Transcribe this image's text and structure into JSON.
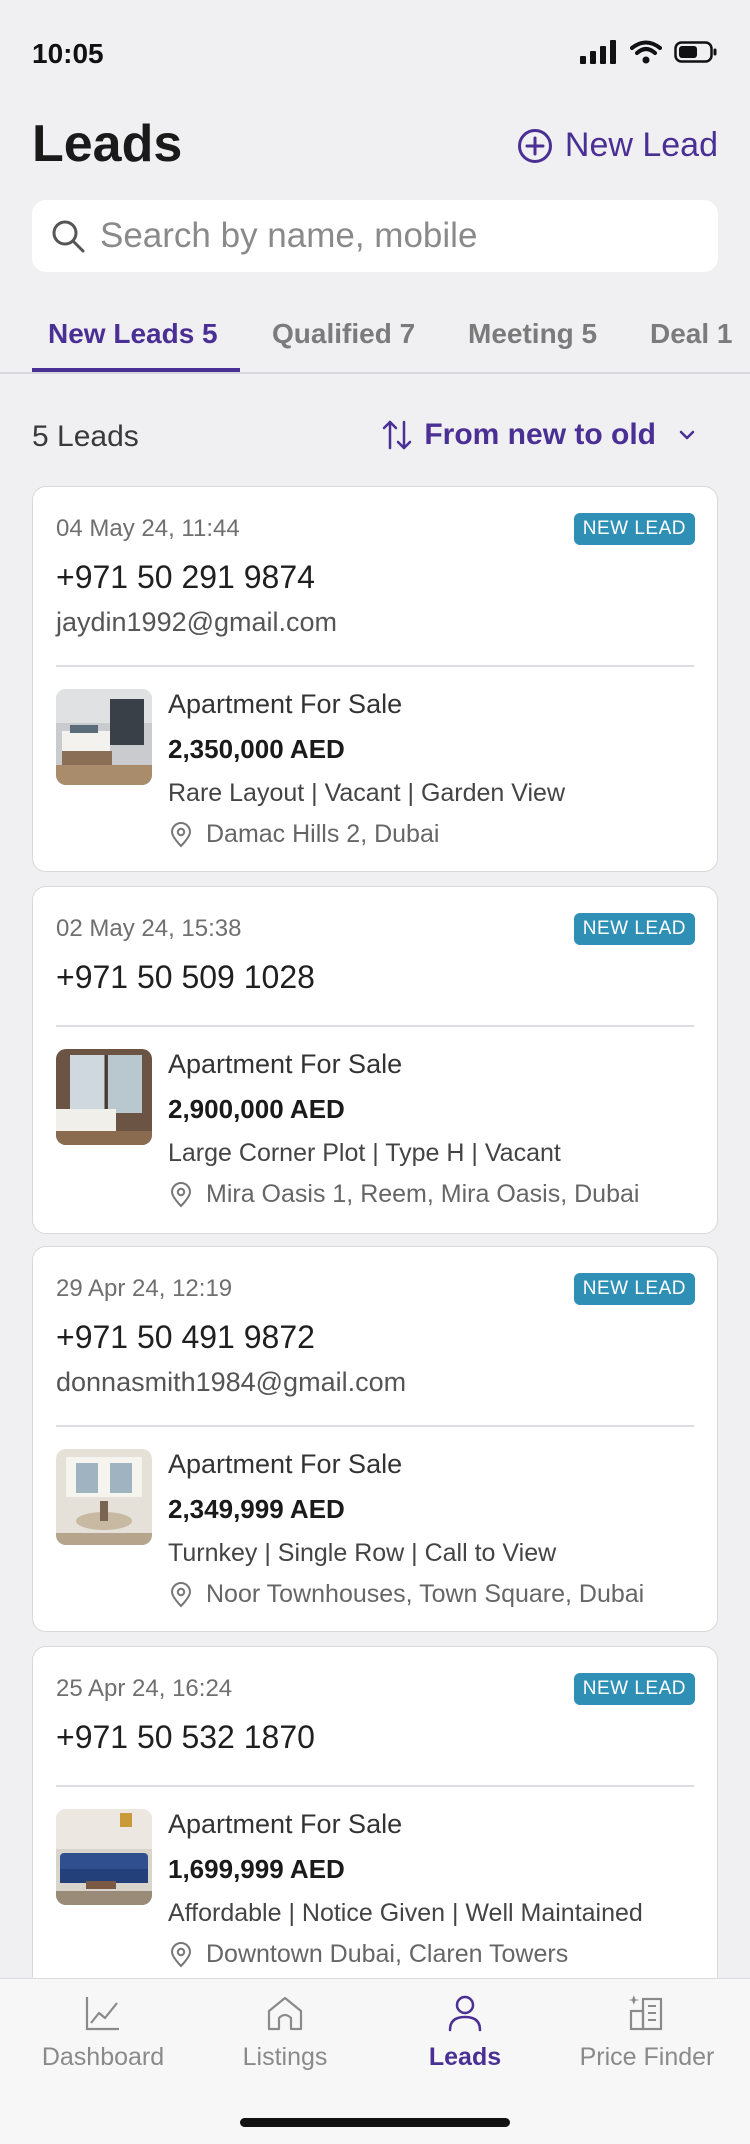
{
  "status": {
    "time": "10:05"
  },
  "header": {
    "title": "Leads",
    "new_lead_label": "New Lead"
  },
  "search": {
    "placeholder": "Search by name, mobile",
    "value": ""
  },
  "tabs": [
    {
      "label": "New Leads 5",
      "active": true
    },
    {
      "label": "Qualified 7",
      "active": false
    },
    {
      "label": "Meeting 5",
      "active": false
    },
    {
      "label": "Deal 1",
      "active": false
    }
  ],
  "list": {
    "count_label": "5 Leads",
    "sort_label": "From new to old"
  },
  "leads": [
    {
      "date": "04 May 24, 11:44",
      "badge": "NEW LEAD",
      "phone": "+971 50 291 9874",
      "email": "jaydin1992@gmail.com",
      "listing": {
        "type": "Apartment For Sale",
        "price": "2,350,000 AED",
        "tags": "Rare Layout | Vacant | Garden View",
        "location": "Damac Hills 2, Dubai"
      }
    },
    {
      "date": "02 May 24, 15:38",
      "badge": "NEW LEAD",
      "phone": "+971 50 509 1028",
      "email": "",
      "listing": {
        "type": "Apartment For Sale",
        "price": "2,900,000 AED",
        "tags": "Large Corner Plot | Type H | Vacant",
        "location": "Mira Oasis 1, Reem, Mira Oasis, Dubai"
      }
    },
    {
      "date": "29 Apr 24, 12:19",
      "badge": "NEW LEAD",
      "phone": "+971 50 491 9872",
      "email": "donnasmith1984@gmail.com",
      "listing": {
        "type": "Apartment For Sale",
        "price": "2,349,999 AED",
        "tags": "Turnkey | Single Row | Call to View",
        "location": "Noor Townhouses, Town Square, Dubai"
      }
    },
    {
      "date": "25 Apr 24, 16:24",
      "badge": "NEW LEAD",
      "phone": "+971 50 532 1870",
      "email": "",
      "listing": {
        "type": "Apartment For Sale",
        "price": "1,699,999 AED",
        "tags": "Affordable | Notice Given | Well Maintained",
        "location": "Downtown Dubai, Claren Towers"
      }
    }
  ],
  "nav": [
    {
      "label": "Dashboard",
      "icon": "chart-icon"
    },
    {
      "label": "Listings",
      "icon": "home-icon"
    },
    {
      "label": "Leads",
      "icon": "person-icon",
      "active": true
    },
    {
      "label": "Price Finder",
      "icon": "building-icon"
    }
  ],
  "colors": {
    "accent": "#4a2f94",
    "badge": "#2f8fb5",
    "background": "#f0eff1"
  }
}
